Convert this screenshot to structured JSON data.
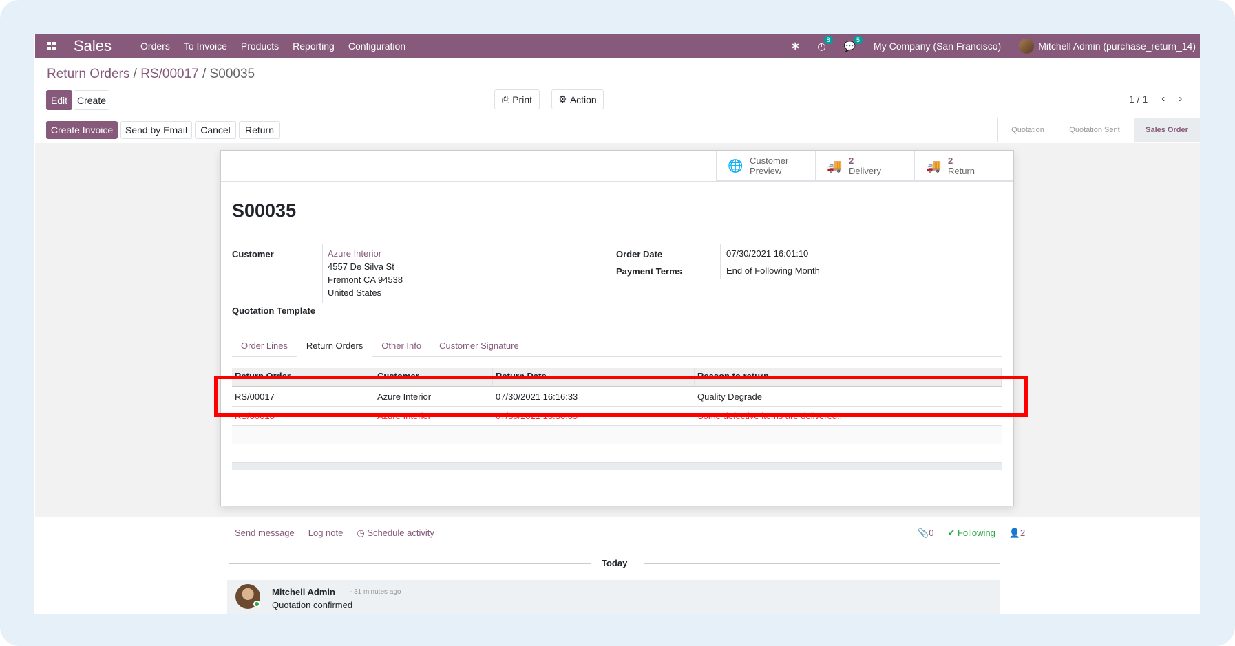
{
  "navbar": {
    "app_name": "Sales",
    "menu": [
      "Orders",
      "To Invoice",
      "Products",
      "Reporting",
      "Configuration"
    ],
    "activity_count": "8",
    "messages_count": "5",
    "company": "My Company (San Francisco)",
    "user": "Mitchell Admin (purchase_return_14)"
  },
  "breadcrumb": {
    "first": "Return Orders",
    "sep": " / ",
    "second": "RS/00017",
    "current": "S00035"
  },
  "toolbar": {
    "edit": "Edit",
    "create": "Create",
    "print": "Print",
    "action": "Action",
    "pager": "1 / 1"
  },
  "actions": {
    "create_invoice": "Create Invoice",
    "send_email": "Send by Email",
    "cancel": "Cancel",
    "return": "Return"
  },
  "stages": [
    "Quotation",
    "Quotation Sent",
    "Sales Order"
  ],
  "smart_buttons": {
    "preview": {
      "line1": "Customer",
      "line2": "Preview"
    },
    "delivery": {
      "count": "2",
      "label": "Delivery"
    },
    "return": {
      "count": "2",
      "label": "Return"
    }
  },
  "record": {
    "name": "S00035",
    "customer_label": "Customer",
    "customer_name": "Azure Interior",
    "address1": "4557 De Silva St",
    "address2": "Fremont CA 94538",
    "address3": "United States",
    "template_label": "Quotation Template",
    "order_date_label": "Order Date",
    "order_date": "07/30/2021 16:01:10",
    "payment_terms_label": "Payment Terms",
    "payment_terms": "End of Following Month"
  },
  "tabs": [
    "Order Lines",
    "Return Orders",
    "Other Info",
    "Customer Signature"
  ],
  "return_table": {
    "headers": [
      "Return Order",
      "Customer",
      "Return Date",
      "Reason to return"
    ],
    "rows": [
      [
        "RS/00017",
        "Azure Interior",
        "07/30/2021 16:16:33",
        "Quality Degrade"
      ],
      [
        "RS/00018",
        "Azure Interior",
        "07/30/2021 16:30:05",
        "Some defective items are delivered!!"
      ]
    ]
  },
  "chatter": {
    "send_message": "Send message",
    "log_note": "Log note",
    "schedule_activity": "Schedule activity",
    "attachments": "0",
    "following": "Following",
    "followers": "2",
    "today": "Today",
    "author": "Mitchell Admin",
    "time": "- 31 minutes ago",
    "body": "Quotation confirmed"
  },
  "colors": {
    "brand": "#875a7b",
    "highlight": "#ff0000",
    "danger": "#dc3545"
  }
}
